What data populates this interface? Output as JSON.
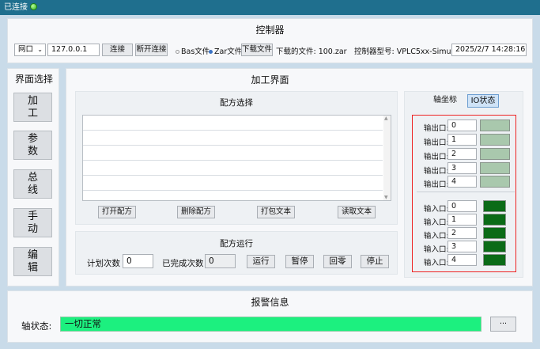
{
  "titlebar": {
    "status": "已连接"
  },
  "controller": {
    "title": "控制器",
    "port_select": "网口",
    "ip": "127.0.0.1",
    "connect": "连接",
    "disconnect": "断开连接",
    "bas_file": "Bas文件",
    "zar_file": "Zar文件",
    "download_btn": "下载文件",
    "downloaded_label": "下载的文件: 100.zar",
    "model_label": "控制器型号: VPLC5xx-Simu",
    "datetime": "2025/2/7 14:28:16"
  },
  "interface_select": {
    "title": "界面选择",
    "items": [
      "加工",
      "参数",
      "总线",
      "手动",
      "编辑"
    ]
  },
  "process": {
    "title": "加工界面",
    "recipe_select": {
      "title": "配方选择",
      "rows": [
        "",
        "",
        "",
        "",
        ""
      ],
      "buttons": [
        "打开配方",
        "删除配方",
        "打包文本",
        "读取文本"
      ]
    },
    "recipe_run": {
      "title": "配方运行",
      "plan_label": "计划次数",
      "plan_value": "0",
      "done_label": "已完成次数",
      "done_value": "0",
      "buttons": [
        "运行",
        "暂停",
        "回零",
        "停止"
      ]
    }
  },
  "io_panel": {
    "tabs": [
      "轴坐标",
      "IO状态"
    ],
    "active_tab": "IO状态",
    "outputs": [
      {
        "label": "输出口:",
        "value": "0"
      },
      {
        "label": "输出口:",
        "value": "1"
      },
      {
        "label": "输出口:",
        "value": "2"
      },
      {
        "label": "输出口:",
        "value": "3"
      },
      {
        "label": "输出口:",
        "value": "4"
      }
    ],
    "inputs": [
      {
        "label": "输入口:",
        "value": "0"
      },
      {
        "label": "输入口:",
        "value": "1"
      },
      {
        "label": "输入口:",
        "value": "2"
      },
      {
        "label": "输入口:",
        "value": "3"
      },
      {
        "label": "输入口:",
        "value": "4"
      }
    ],
    "output_color": "#a9c8ad",
    "input_color": "#0b6b17"
  },
  "alarm": {
    "title": "报警信息",
    "axis_label": "轴状态:",
    "status": "一切正常",
    "status_color": "#1cf07f",
    "more": "···"
  }
}
